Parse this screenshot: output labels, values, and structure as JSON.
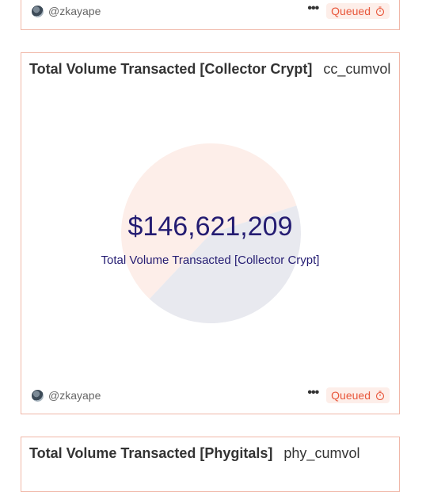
{
  "top_card": {
    "author": "@zkayape",
    "status": "Queued"
  },
  "main_card": {
    "title": "Total Volume Transacted [Collector Crypt]",
    "query_name": "cc_cumvol",
    "value": "$146,621,209",
    "value_label": "Total Volume Transacted [Collector Crypt]",
    "author": "@zkayape",
    "status": "Queued"
  },
  "bottom_card": {
    "title": "Total Volume Transacted [Phygitals]",
    "query_name": "phy_cumvol"
  },
  "chart_data": {
    "type": "pie",
    "values": [
      0.58,
      0.42
    ],
    "colors": [
      "#fdeee9",
      "#e8e9ef"
    ]
  },
  "colors": {
    "border": "#f0b7a8",
    "accent": "#e8563a",
    "counter_text": "#241c72"
  }
}
